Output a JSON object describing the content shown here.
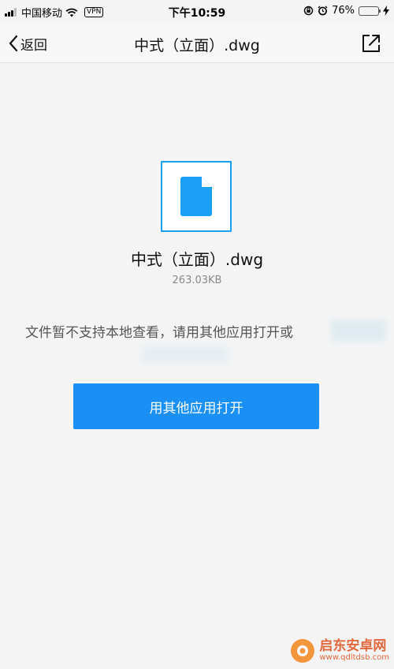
{
  "status_bar": {
    "carrier": "中国移动",
    "vpn_label": "VPN",
    "time": "下午10:59",
    "battery_percent": "76%",
    "battery_level": 0.76
  },
  "nav": {
    "back_label": "返回",
    "title": "中式（立面）.dwg"
  },
  "file": {
    "name": "中式（立面）.dwg",
    "size": "263.03KB"
  },
  "hint_text": "文件暂不支持本地查看，请用其他应用打开或",
  "open_button_label": "用其他应用打开",
  "watermark": {
    "name": "启东安卓网",
    "url": "www.qdltdsb.com"
  },
  "colors": {
    "accent": "#1a8ff6",
    "icon_blue": "#1aa0f4",
    "background": "#f4f4f4"
  }
}
